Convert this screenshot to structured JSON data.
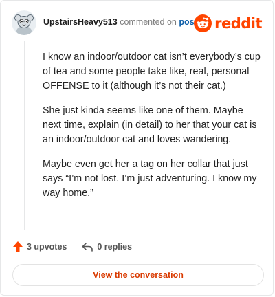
{
  "header": {
    "username": "UpstairsHeavy513",
    "action_text": "commented on",
    "post_link": "post",
    "avatar_icon": "snoo-avatar-icon",
    "logo_icon": "reddit-logo-icon",
    "logo_text": "reddit"
  },
  "comment": {
    "paragraphs": [
      "I know an indoor/outdoor cat isn’t everybody’s cup of tea and some people take like, real, personal OFFENSE to it (although it’s not their cat.)",
      "She just kinda seems like one of them. Maybe next time, explain (in detail) to her that your cat is an indoor/outdoor cat and loves wandering.",
      "Maybe even get her a tag on her collar that just says “I’m not lost. I’m just adventuring. I know my way home.”"
    ]
  },
  "footer": {
    "upvotes": "3 upvotes",
    "replies": "0 replies",
    "upvote_icon": "upvote-arrow-icon",
    "reply_icon": "reply-arrow-icon"
  },
  "cta": {
    "label": "View the conversation"
  },
  "colors": {
    "brand": "#ff4500",
    "link": "#0e5ea8",
    "cta_text": "#d93a00"
  }
}
